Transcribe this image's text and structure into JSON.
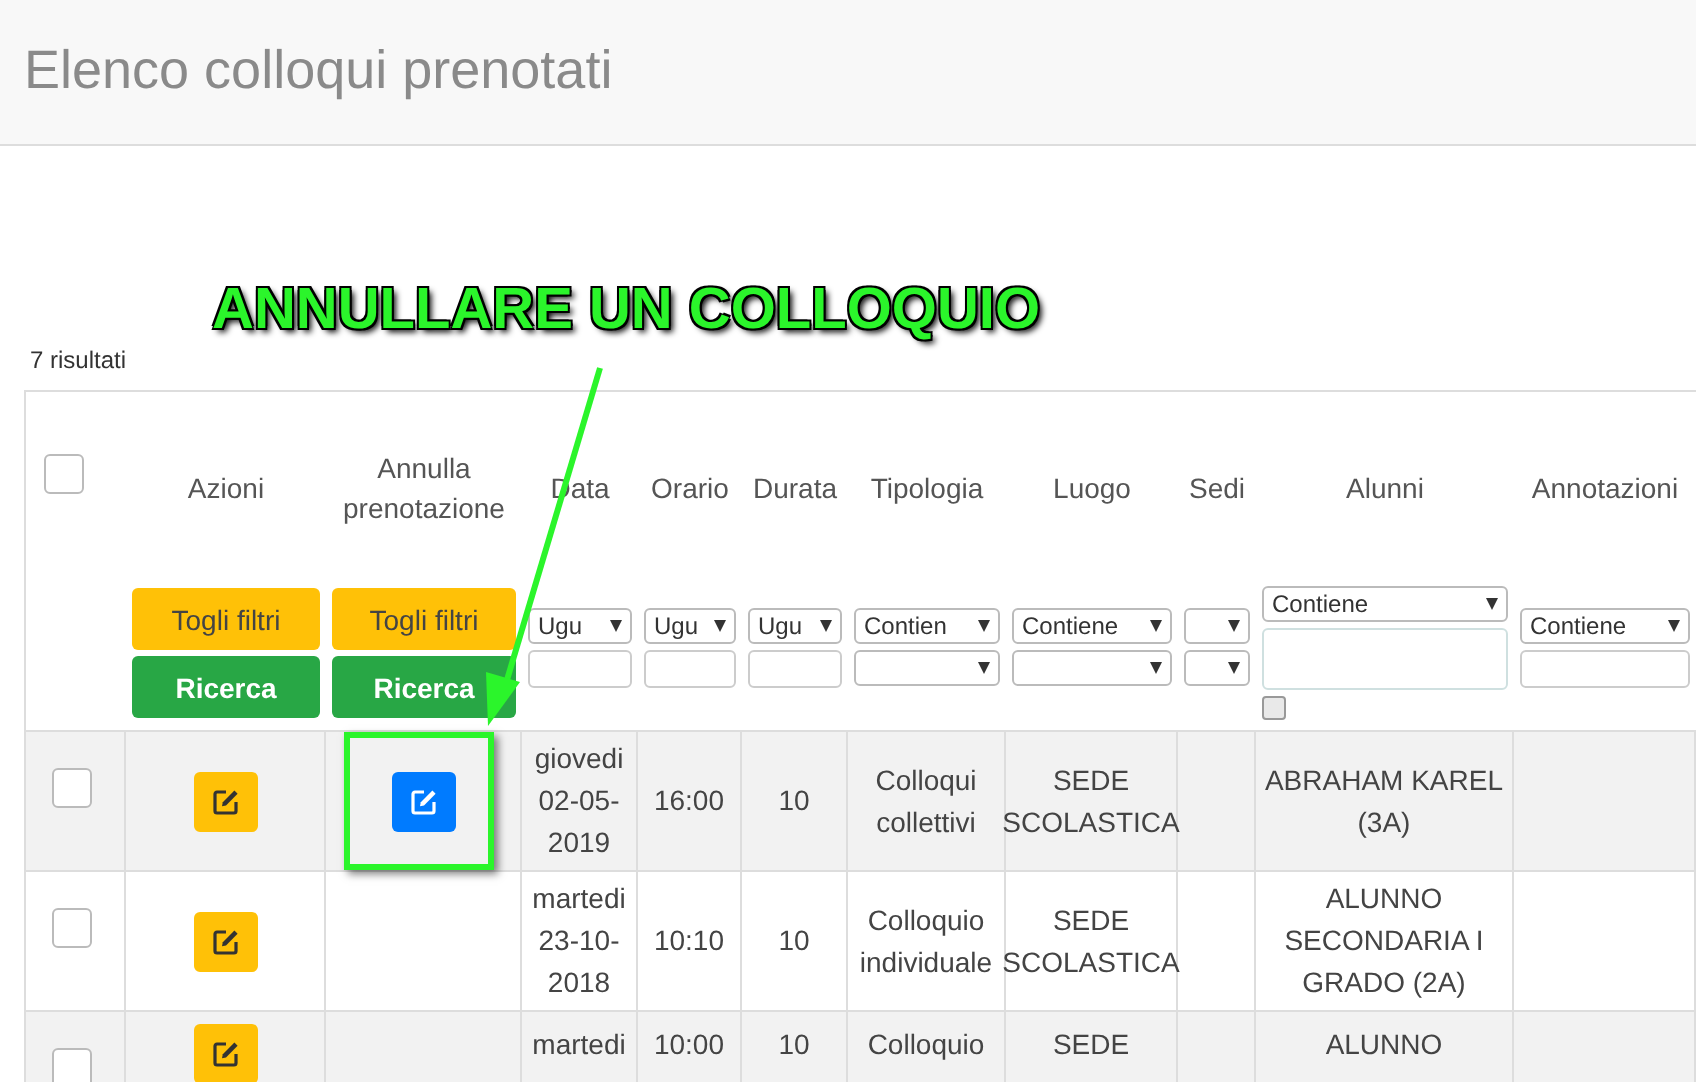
{
  "page": {
    "title": "Elenco colloqui prenotati"
  },
  "results_count": "7 risultati",
  "table": {
    "select_all": {
      "checked": false
    },
    "columns": [
      {
        "label": "Azioni",
        "filter": {
          "kind": "buttons",
          "reset_label": "Togli filtri",
          "search_label": "Ricerca"
        }
      },
      {
        "label": "Annulla prenotazione",
        "filter": {
          "kind": "buttons",
          "reset_label": "Togli filtri",
          "search_label": "Ricerca"
        }
      },
      {
        "label": "Data",
        "filter": {
          "kind": "text",
          "operator": "Ugu"
        }
      },
      {
        "label": "Orario",
        "filter": {
          "kind": "text",
          "operator": "Ugu"
        }
      },
      {
        "label": "Durata",
        "filter": {
          "kind": "text",
          "operator": "Ugu"
        }
      },
      {
        "label": "Tipologia",
        "filter": {
          "kind": "choice",
          "operator": "Contien"
        }
      },
      {
        "label": "Luogo",
        "filter": {
          "kind": "choice",
          "operator": "Contiene"
        }
      },
      {
        "label": "Sedi",
        "filter": {
          "kind": "choice"
        }
      },
      {
        "label": "Alunni",
        "filter": {
          "kind": "multi",
          "operator": "Contiene",
          "option_checked": false
        }
      },
      {
        "label": "Annotazioni",
        "filter": {
          "kind": "text",
          "operator": "Contiene"
        }
      }
    ],
    "rows": [
      {
        "checked": false,
        "cancellable": true,
        "date": "giovedi 02-05-2019",
        "time": "16:00",
        "duration": "10",
        "type": "Colloqui collettivi",
        "place": "SEDE SCOLASTICA",
        "student": "ABRAHAM KAREL (3A)"
      },
      {
        "checked": false,
        "cancellable": false,
        "date": "martedi 23-10-2018",
        "time": "10:10",
        "duration": "10",
        "type": "Colloquio individuale",
        "place": "SEDE SCOLASTICA",
        "student": "ALUNNO SECONDARIA I GRADO (2A)"
      },
      {
        "checked": false,
        "cancellable": false,
        "date": "martedi",
        "time": "10:00",
        "duration": "10",
        "type": "Colloquio",
        "place": "SEDE",
        "student": "ALUNNO"
      }
    ]
  },
  "annotation": {
    "text": "ANNULLARE UN COLLOQUIO"
  }
}
